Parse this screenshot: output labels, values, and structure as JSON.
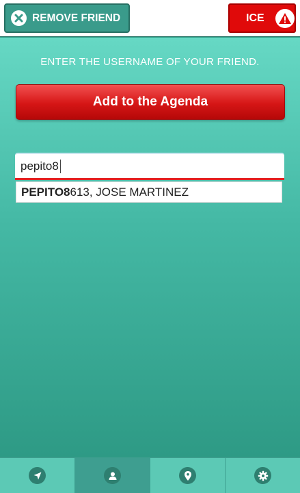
{
  "header": {
    "remove_friend_label": "REMOVE FRIEND",
    "ice_label": "ICE"
  },
  "main": {
    "instruction": "ENTER THE USERNAME OF YOUR FRIEND.",
    "add_button_label": "Add to the Agenda",
    "search": {
      "value": "pepito8"
    },
    "suggestions": [
      {
        "match": "PEPITO8",
        "rest": "613, JOSE MARTINEZ"
      }
    ]
  },
  "bottom_nav": {
    "items": [
      {
        "icon": "location-arrow-icon"
      },
      {
        "icon": "user-icon",
        "active": true
      },
      {
        "icon": "map-pin-icon"
      },
      {
        "icon": "gear-icon"
      }
    ]
  },
  "colors": {
    "accent_red": "#e00a0a",
    "teal": "#3a9b8b",
    "nav_bg": "#5cc9b5"
  }
}
